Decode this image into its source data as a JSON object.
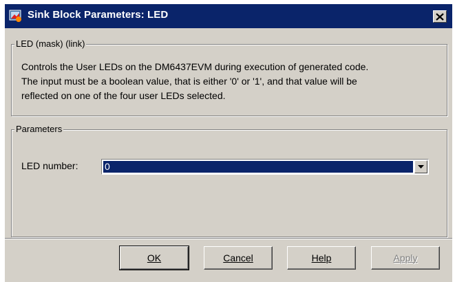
{
  "window": {
    "title": "Sink Block Parameters: LED",
    "close_glyph": "✕"
  },
  "mask_group": {
    "legend": "LED (mask) (link)",
    "description_lines": [
      "Controls the User LEDs on the DM6437EVM during execution of generated code.",
      "The input must be a boolean value, that is either '0' or '1', and that value will be",
      "reflected on one of the four user LEDs selected."
    ]
  },
  "params_group": {
    "legend": "Parameters",
    "led_number_label": "LED number:",
    "led_number_value": "0"
  },
  "buttons": {
    "ok": "OK",
    "cancel": "Cancel",
    "help": "Help",
    "apply": "Apply"
  },
  "colors": {
    "titlebar": "#0a246a",
    "face": "#d4d0c8",
    "selection": "#0a246a"
  },
  "icons": {
    "app": "simulink-block-icon",
    "close": "close-icon",
    "dropdown": "chevron-down-icon"
  }
}
